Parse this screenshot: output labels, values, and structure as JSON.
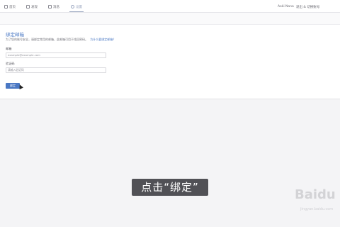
{
  "tabs": [
    {
      "label": "首页",
      "icon": "home-icon"
    },
    {
      "label": "发现",
      "icon": "discover-icon"
    },
    {
      "label": "消息",
      "icon": "message-icon"
    },
    {
      "label": "设置",
      "icon": "settings-icon"
    }
  ],
  "user": {
    "name": "Aoki Nana",
    "logout": "退出 & 切换账号"
  },
  "form": {
    "title": "绑定邮箱",
    "description": "为了您的账号安全，请绑定常用的邮箱，此邮箱可用于找回密码。",
    "description_link": "为什么要绑定邮箱？",
    "email_label": "邮箱",
    "email_value": "example@example.com",
    "code_label": "验证码",
    "code_placeholder": "请输入验证码",
    "submit_label": "绑定"
  },
  "caption": "点击“绑定”",
  "watermark": {
    "logo": "Baidu",
    "sub": "jingyan.baidu.com"
  },
  "colors": {
    "accent": "#4a78c4",
    "background": "#f4f4f6",
    "caption_bg": "#2d2d32"
  }
}
